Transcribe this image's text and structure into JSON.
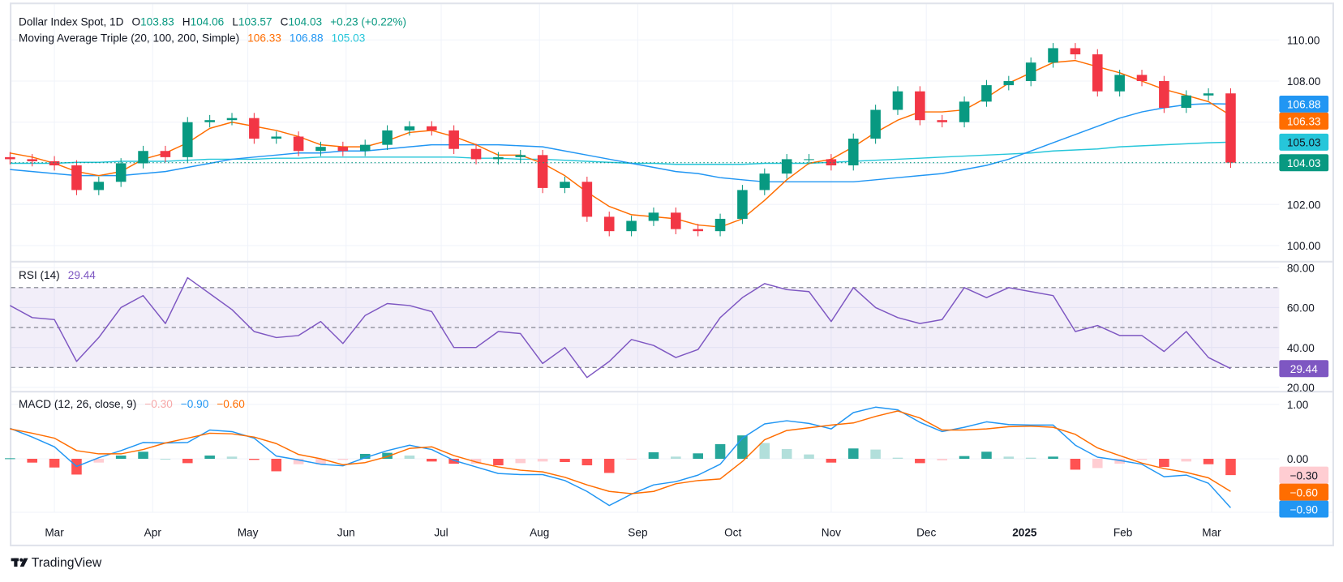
{
  "header": {
    "symbol": "Dollar Index Spot, 1D",
    "o_label": "O",
    "o": "103.83",
    "h_label": "H",
    "h": "104.06",
    "l_label": "L",
    "l": "103.57",
    "c_label": "C",
    "c": "104.03",
    "change": "+0.23 (+0.22%)",
    "ma_title": "Moving Average Triple (20, 100, 200, Simple)",
    "ma20": "106.33",
    "ma100": "106.88",
    "ma200": "105.03",
    "rsi_title": "RSI (14)",
    "rsi": "29.44",
    "macd_title": "MACD (12, 26, close, 9)",
    "macd_hist": "−0.30",
    "macd_line": "−0.90",
    "macd_signal": "−0.60"
  },
  "colors": {
    "up": "#089981",
    "down": "#f23645",
    "ma20": "#ff6d00",
    "ma100": "#2196f3",
    "ma200": "#26c6da",
    "rsi": "#7e57c2",
    "macd": "#2196f3",
    "signal": "#ff6d00",
    "hist_up_strong": "#26a69a",
    "hist_up_weak": "#b2dfdb",
    "hist_down_strong": "#ff5252",
    "hist_down_weak": "#ffcdd2",
    "grid": "#f0f3fa",
    "border": "#e0e3eb"
  },
  "branding": {
    "name": "TradingView",
    "logo_icon": "tradingview-logo-icon"
  },
  "chart_data": [
    {
      "type": "candlestick",
      "title": "Dollar Index Spot, 1D",
      "ylim": [
        99.2,
        111
      ],
      "yticks": [
        "100.00",
        "102.00",
        "104.00",
        "106.00",
        "108.00",
        "110.00"
      ],
      "x": [
        "2024-02-16",
        "2024-02-23",
        "2024-03-01",
        "2024-03-08",
        "2024-03-15",
        "2024-03-22",
        "2024-03-29",
        "2024-04-05",
        "2024-04-12",
        "2024-04-19",
        "2024-04-26",
        "2024-05-03",
        "2024-05-10",
        "2024-05-17",
        "2024-05-24",
        "2024-05-31",
        "2024-06-07",
        "2024-06-14",
        "2024-06-21",
        "2024-06-28",
        "2024-07-05",
        "2024-07-12",
        "2024-07-19",
        "2024-07-26",
        "2024-08-02",
        "2024-08-09",
        "2024-08-16",
        "2024-08-23",
        "2024-08-30",
        "2024-09-06",
        "2024-09-13",
        "2024-09-20",
        "2024-09-27",
        "2024-10-04",
        "2024-10-11",
        "2024-10-18",
        "2024-10-25",
        "2024-11-01",
        "2024-11-08",
        "2024-11-15",
        "2024-11-22",
        "2024-11-29",
        "2024-12-06",
        "2024-12-13",
        "2024-12-20",
        "2024-12-27",
        "2025-01-03",
        "2025-01-10",
        "2025-01-17",
        "2025-01-24",
        "2025-01-31",
        "2025-02-07",
        "2025-02-14",
        "2025-02-21",
        "2025-02-28",
        "2025-03-07"
      ],
      "close": [
        104.2,
        104.1,
        103.9,
        102.7,
        103.1,
        104.0,
        104.6,
        104.3,
        106.0,
        106.1,
        106.2,
        105.2,
        105.3,
        104.6,
        104.8,
        104.6,
        104.9,
        105.6,
        105.8,
        105.6,
        104.7,
        104.2,
        104.3,
        104.4,
        102.8,
        103.1,
        101.4,
        100.7,
        101.2,
        101.6,
        100.8,
        100.7,
        101.3,
        102.7,
        103.5,
        104.2,
        104.2,
        103.9,
        105.2,
        106.6,
        107.5,
        106.1,
        106.0,
        107.0,
        107.8,
        108.0,
        108.9,
        109.6,
        109.3,
        107.5,
        108.3,
        108.0,
        106.7,
        107.3,
        107.4,
        104.03
      ],
      "series": [
        {
          "name": "20",
          "values": [
            104.5,
            104.3,
            104.0,
            103.6,
            103.4,
            103.6,
            104.2,
            104.5,
            105.0,
            105.7,
            106.0,
            105.8,
            105.6,
            105.3,
            104.9,
            104.8,
            104.8,
            105.1,
            105.5,
            105.6,
            105.3,
            104.9,
            104.4,
            104.4,
            104.0,
            103.4,
            102.6,
            101.9,
            101.5,
            101.4,
            101.3,
            101.0,
            100.9,
            101.3,
            102.2,
            103.2,
            104.0,
            104.2,
            104.8,
            105.5,
            106.1,
            106.5,
            106.5,
            106.6,
            107.2,
            107.9,
            108.4,
            108.9,
            109.0,
            108.7,
            108.4,
            108.0,
            107.6,
            107.3,
            107.0,
            106.33
          ]
        },
        {
          "name": "100",
          "values": [
            103.7,
            103.6,
            103.5,
            103.4,
            103.4,
            103.4,
            103.5,
            103.6,
            103.8,
            104.0,
            104.2,
            104.3,
            104.4,
            104.5,
            104.5,
            104.6,
            104.6,
            104.7,
            104.8,
            104.9,
            104.9,
            104.9,
            104.9,
            104.85,
            104.8,
            104.6,
            104.4,
            104.2,
            104.0,
            103.8,
            103.6,
            103.5,
            103.3,
            103.2,
            103.1,
            103.1,
            103.1,
            103.1,
            103.1,
            103.2,
            103.3,
            103.4,
            103.5,
            103.7,
            103.9,
            104.2,
            104.6,
            105.0,
            105.4,
            105.8,
            106.2,
            106.5,
            106.7,
            106.85,
            106.9,
            106.88
          ]
        },
        {
          "name": "200",
          "values": [
            104.0,
            104.0,
            104.0,
            104.05,
            104.05,
            104.1,
            104.1,
            104.1,
            104.15,
            104.2,
            104.2,
            104.2,
            104.25,
            104.25,
            104.3,
            104.3,
            104.3,
            104.3,
            104.3,
            104.3,
            104.3,
            104.25,
            104.25,
            104.2,
            104.2,
            104.15,
            104.1,
            104.05,
            104.0,
            104.0,
            103.95,
            103.95,
            103.95,
            103.95,
            104.0,
            104.0,
            104.0,
            104.05,
            104.1,
            104.15,
            104.2,
            104.25,
            104.3,
            104.35,
            104.4,
            104.45,
            104.5,
            104.6,
            104.65,
            104.7,
            104.8,
            104.85,
            104.9,
            104.95,
            105.0,
            105.03
          ]
        }
      ]
    },
    {
      "type": "line",
      "title": "RSI (14)",
      "ylim": [
        20,
        80
      ],
      "yticks": [
        "20.00",
        "40.00",
        "60.00",
        "80.00"
      ],
      "levels": [
        30,
        50,
        70
      ],
      "band": [
        30,
        70
      ],
      "values": [
        61,
        55,
        54,
        33,
        45,
        60,
        66,
        52,
        75,
        67,
        59,
        48,
        45,
        46,
        53,
        42,
        56,
        62,
        61,
        58,
        40,
        40,
        48,
        47,
        32,
        40,
        25,
        33,
        44,
        41,
        35,
        39,
        55,
        65,
        72,
        69,
        68,
        53,
        70,
        60,
        55,
        52,
        54,
        70,
        65,
        70,
        68,
        66,
        48,
        51,
        46,
        46,
        38,
        48,
        35,
        29.44
      ]
    },
    {
      "type": "line+bar",
      "title": "MACD (12, 26, close, 9)",
      "yticks": [
        "0.00",
        "1.00"
      ],
      "macd": [
        0.56,
        0.4,
        0.22,
        -0.14,
        0.02,
        0.15,
        0.3,
        0.29,
        0.3,
        0.53,
        0.5,
        0.38,
        0.05,
        -0.02,
        -0.1,
        -0.13,
        0.02,
        0.15,
        0.25,
        0.17,
        -0.03,
        -0.15,
        -0.27,
        -0.29,
        -0.29,
        -0.4,
        -0.6,
        -0.86,
        -0.65,
        -0.48,
        -0.42,
        -0.3,
        -0.1,
        0.38,
        0.64,
        0.7,
        0.65,
        0.55,
        0.85,
        0.95,
        0.9,
        0.67,
        0.5,
        0.58,
        0.68,
        0.63,
        0.62,
        0.62,
        0.25,
        0.03,
        -0.03,
        -0.1,
        -0.33,
        -0.3,
        -0.45,
        -0.9
      ],
      "signal": [
        0.55,
        0.47,
        0.38,
        0.15,
        0.09,
        0.09,
        0.17,
        0.29,
        0.38,
        0.47,
        0.46,
        0.4,
        0.28,
        0.08,
        0.0,
        -0.11,
        -0.07,
        0.04,
        0.19,
        0.22,
        0.06,
        -0.06,
        -0.15,
        -0.21,
        -0.24,
        -0.34,
        -0.48,
        -0.6,
        -0.64,
        -0.6,
        -0.46,
        -0.4,
        -0.37,
        -0.05,
        0.35,
        0.52,
        0.57,
        0.62,
        0.66,
        0.78,
        0.88,
        0.75,
        0.53,
        0.53,
        0.55,
        0.59,
        0.6,
        0.58,
        0.45,
        0.2,
        0.06,
        -0.08,
        -0.18,
        -0.25,
        -0.35,
        -0.6
      ]
    }
  ],
  "time_axis": {
    "labels": [
      {
        "text": "Mar",
        "date": "2024-03-01",
        "bold": false
      },
      {
        "text": "Apr",
        "date": "2024-04-01",
        "bold": false
      },
      {
        "text": "May",
        "date": "2024-05-01",
        "bold": false
      },
      {
        "text": "Jun",
        "date": "2024-06-01",
        "bold": false
      },
      {
        "text": "Jul",
        "date": "2024-07-01",
        "bold": false
      },
      {
        "text": "Aug",
        "date": "2024-08-01",
        "bold": false
      },
      {
        "text": "Sep",
        "date": "2024-09-01",
        "bold": false
      },
      {
        "text": "Oct",
        "date": "2024-10-01",
        "bold": false
      },
      {
        "text": "Nov",
        "date": "2024-11-01",
        "bold": false
      },
      {
        "text": "Dec",
        "date": "2024-12-01",
        "bold": false
      },
      {
        "text": "2025",
        "date": "2025-01-01",
        "bold": true
      },
      {
        "text": "Feb",
        "date": "2025-02-01",
        "bold": false
      },
      {
        "text": "Mar",
        "date": "2025-03-01",
        "bold": false
      }
    ]
  },
  "tags": {
    "price": [
      {
        "text": "106.88",
        "value": 106.88,
        "bg": "#2196f3",
        "fg": "#ffffff"
      },
      {
        "text": "106.33",
        "value": 106.33,
        "bg": "#ff6d00",
        "fg": "#ffffff"
      },
      {
        "text": "105.03",
        "value": 105.03,
        "bg": "#26c6da",
        "fg": "#131722"
      },
      {
        "text": "104.03",
        "value": 104.03,
        "bg": "#089981",
        "fg": "#ffffff"
      }
    ],
    "rsi": [
      {
        "text": "29.44",
        "value": 29.44,
        "bg": "#7e57c2",
        "fg": "#ffffff"
      }
    ],
    "macd": [
      {
        "text": "−0.30",
        "value": -0.3,
        "bg": "#ffcdd2",
        "fg": "#131722"
      },
      {
        "text": "−0.60",
        "value": -0.6,
        "bg": "#ff6d00",
        "fg": "#ffffff"
      },
      {
        "text": "−0.90",
        "value": -0.9,
        "bg": "#2196f3",
        "fg": "#ffffff"
      }
    ]
  }
}
